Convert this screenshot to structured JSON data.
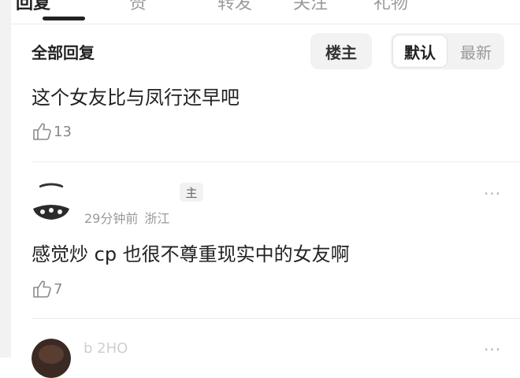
{
  "tabs": [
    {
      "label": "回复",
      "active": true
    },
    {
      "label": "赞"
    },
    {
      "label": "转发"
    },
    {
      "label": "关注"
    },
    {
      "label": "礼物"
    }
  ],
  "section": {
    "title": "全部回复",
    "op_filter_label": "楼主",
    "sort_default_label": "默认",
    "sort_latest_label": "最新"
  },
  "comments": [
    {
      "text": "这个女友比与凤行还早吧",
      "likes": "13"
    },
    {
      "badge": "主",
      "time": "29分钟前",
      "location": "浙江",
      "text": "感觉炒 cp 也很不尊重现实中的女友啊",
      "likes": "7",
      "more": "···"
    },
    {
      "name_fragment": "b    2HO",
      "more": "···"
    }
  ],
  "colors": {
    "text": "#222222",
    "muted": "#999999",
    "chip_bg": "#f2f2f2",
    "divider": "#ededed"
  }
}
